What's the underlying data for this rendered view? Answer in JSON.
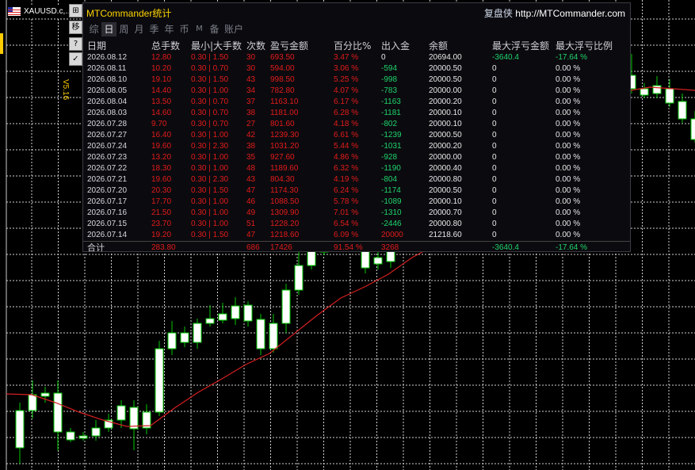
{
  "symbol": {
    "name": "XAUUSD.c,…"
  },
  "toolbar": {
    "btn1": "⊞",
    "btn2": "移",
    "btn3": "?",
    "btn4": "✓"
  },
  "version_label": "V5.16",
  "panel": {
    "title": "MTCommander统计",
    "link_prefix": "复盘侠",
    "link_url": "http://MTCommander.com",
    "tabs": [
      "综",
      "日",
      "周",
      "月",
      "季",
      "年",
      "币",
      "M",
      "备",
      "账户"
    ],
    "active_tab": "日",
    "headers": [
      "日期",
      "总手数",
      "最小|大手数",
      "次数",
      "盈亏金额",
      "百分比%",
      "出入金",
      "余额",
      "最大浮亏金额",
      "最大浮亏比例"
    ],
    "rows": [
      [
        "2026.08.12",
        "12.80",
        "0.30 | 1.50",
        "30",
        "693.50",
        "3.47 %",
        "0",
        "20694.00",
        "-3640.4",
        "-17.64 %"
      ],
      [
        "2026.08.11",
        "10.20",
        "0.30 | 0.70",
        "30",
        "594.00",
        "3.06 %",
        "-594",
        "20000.50",
        "0",
        "0.00 %"
      ],
      [
        "2026.08.10",
        "19.10",
        "0.30 | 1.50",
        "43",
        "998.50",
        "5.25 %",
        "-998",
        "20000.50",
        "0",
        "0.00 %"
      ],
      [
        "2026.08.05",
        "14.40",
        "0.30 | 1.00",
        "34",
        "782.80",
        "4.07 %",
        "-783",
        "20000.00",
        "0",
        "0.00 %"
      ],
      [
        "2026.08.04",
        "13.50",
        "0.30 | 0.70",
        "37",
        "1163.10",
        "6.17 %",
        "-1163",
        "20000.20",
        "0",
        "0.00 %"
      ],
      [
        "2026.08.03",
        "14.60",
        "0.30 | 0.70",
        "38",
        "1181.00",
        "6.28 %",
        "-1181",
        "20000.10",
        "0",
        "0.00 %"
      ],
      [
        "2026.07.28",
        "9.70",
        "0.30 | 0.70",
        "27",
        "801.60",
        "4.18 %",
        "-802",
        "20000.10",
        "0",
        "0.00 %"
      ],
      [
        "2026.07.27",
        "16.40",
        "0.30 | 1.00",
        "42",
        "1239.30",
        "6.61 %",
        "-1239",
        "20000.50",
        "0",
        "0.00 %"
      ],
      [
        "2026.07.24",
        "19.60",
        "0.30 | 2.30",
        "38",
        "1031.20",
        "5.44 %",
        "-1031",
        "20000.20",
        "0",
        "0.00 %"
      ],
      [
        "2026.07.23",
        "13.20",
        "0.30 | 1.00",
        "35",
        "927.60",
        "4.86 %",
        "-928",
        "20000.00",
        "0",
        "0.00 %"
      ],
      [
        "2026.07.22",
        "18.30",
        "0.30 | 1.00",
        "48",
        "1189.60",
        "6.32 %",
        "-1190",
        "20000.40",
        "0",
        "0.00 %"
      ],
      [
        "2026.07.21",
        "19.60",
        "0.30 | 2.30",
        "43",
        "804.30",
        "4.19 %",
        "-804",
        "20000.80",
        "0",
        "0.00 %"
      ],
      [
        "2026.07.20",
        "20.30",
        "0.30 | 1.50",
        "47",
        "1174.30",
        "6.24 %",
        "-1174",
        "20000.50",
        "0",
        "0.00 %"
      ],
      [
        "2026.07.17",
        "17.70",
        "0.30 | 1.00",
        "46",
        "1088.50",
        "5.78 %",
        "-1089",
        "20000.10",
        "0",
        "0.00 %"
      ],
      [
        "2026.07.16",
        "21.50",
        "0.30 | 1.00",
        "49",
        "1309.90",
        "7.01 %",
        "-1310",
        "20000.70",
        "0",
        "0.00 %"
      ],
      [
        "2026.07.15",
        "23.70",
        "0.30 | 1.00",
        "51",
        "1228.20",
        "6.54 %",
        "-2446",
        "20000.80",
        "0",
        "0.00 %"
      ],
      [
        "2026.07.14",
        "19.20",
        "0.30 | 1.50",
        "47",
        "1218.60",
        "6.09 %",
        "20000",
        "21218.60",
        "0",
        "0.00 %"
      ]
    ],
    "totals": [
      "合计",
      "283.80",
      "",
      "686",
      "17426",
      "91.54 %",
      "3268",
      "",
      "-3640.4",
      "-17.64 %"
    ]
  },
  "chart_colors": {
    "bull": "#ffffff",
    "bear": "#ffffff",
    "wick": "#00c800",
    "ma": "#d42020",
    "grid": "#d0d0d0"
  }
}
